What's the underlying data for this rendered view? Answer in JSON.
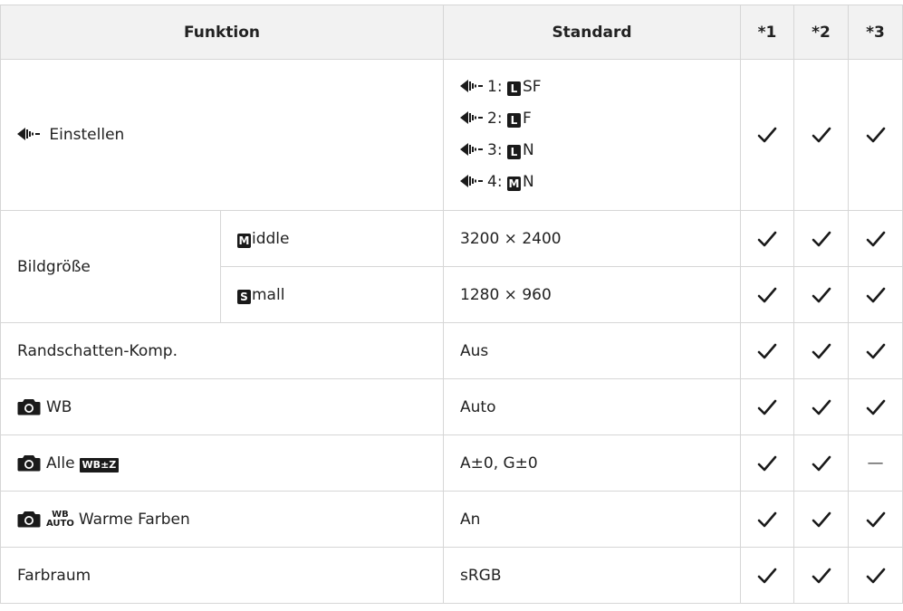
{
  "header": {
    "funktion": "Funktion",
    "standard": "Standard",
    "c1": "*1",
    "c2": "*2",
    "c3": "*3"
  },
  "rows": {
    "einstellen": {
      "label": "Einstellen",
      "modes": [
        {
          "num": "1:",
          "size": "L",
          "quality": "SF"
        },
        {
          "num": "2:",
          "size": "L",
          "quality": "F"
        },
        {
          "num": "3:",
          "size": "L",
          "quality": "N"
        },
        {
          "num": "4:",
          "size": "M",
          "quality": "N"
        }
      ]
    },
    "bildgroesse": {
      "label": "Bildgröße",
      "middle_badge": "M",
      "middle_rest": "iddle",
      "middle_value": "3200 × 2400",
      "small_badge": "S",
      "small_rest": "mall",
      "small_value": "1280 × 960"
    },
    "randschatten": {
      "label": "Randschatten-Komp.",
      "value": "Aus"
    },
    "wb": {
      "label": "WB",
      "value": "Auto"
    },
    "alle": {
      "label": "Alle",
      "badge": "WB±Z",
      "value": "A±0, G±0"
    },
    "warme": {
      "badge_top": "WB",
      "badge_bottom": "AUTO",
      "label": "Warme Farben",
      "value": "An"
    },
    "farbraum": {
      "label": "Farbraum",
      "value": "sRGB"
    }
  },
  "dash_symbol": "—",
  "icons": {
    "check": "check-icon",
    "sequence": "sequential-shooting-icon",
    "camera": "camera-icon"
  }
}
